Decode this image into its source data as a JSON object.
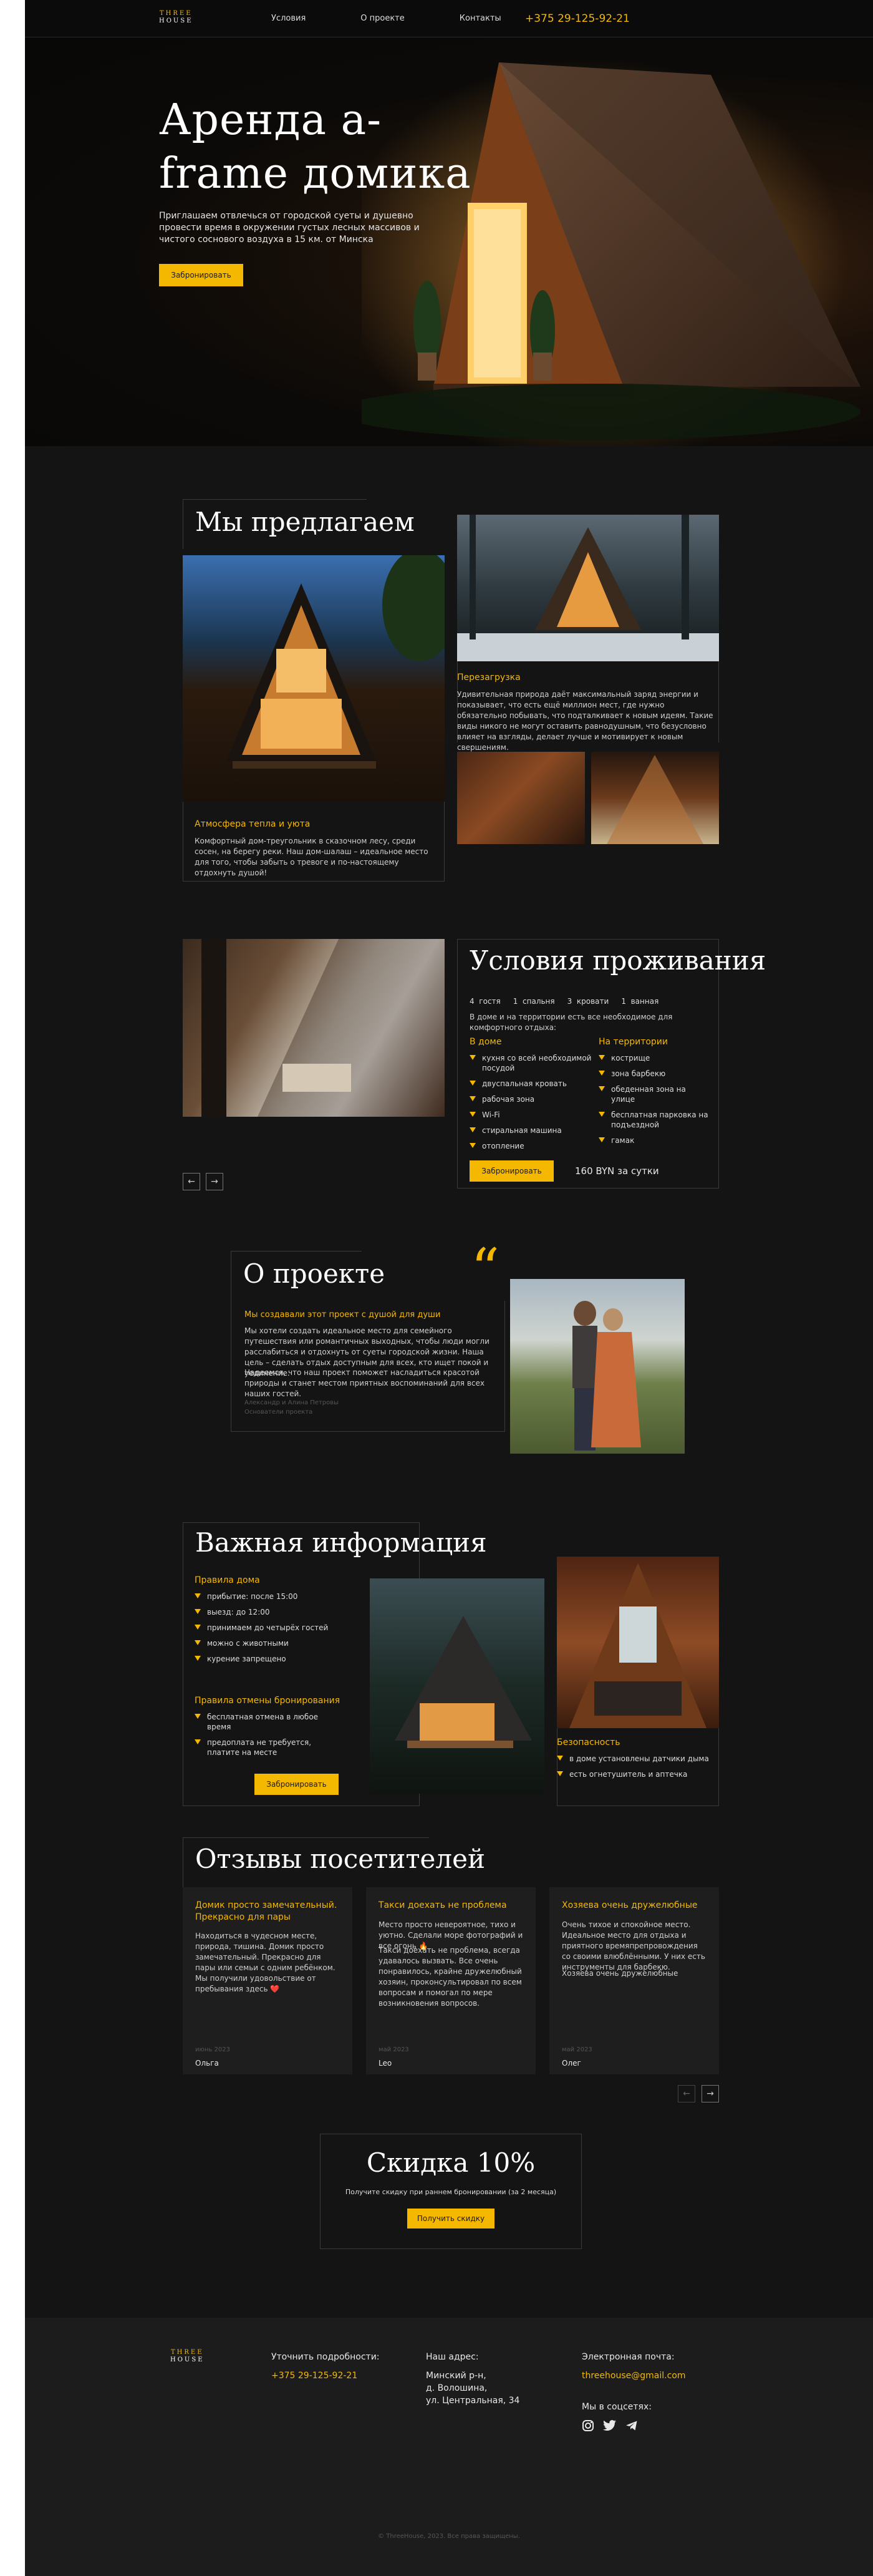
{
  "logo": {
    "top": "THREE",
    "bottom": "HOUSE"
  },
  "nav": {
    "items": [
      "Условия",
      "О проекте",
      "Контакты"
    ],
    "phone": "+375 29-125-92-21"
  },
  "hero": {
    "title": "Аренда a-frame домика",
    "text": "Приглашаем отвлечься от городской суеты и душевно провести время в окружении густых лесных массивов и чистого соснового воздуха в 15 км. от Минска",
    "button": "Забронировать"
  },
  "offer": {
    "title": "Мы предлагаем",
    "card1": {
      "heading": "Атмосфера тепла и уюта",
      "text": "Комфортный дом-треугольник в сказочном лесу, среди сосен, на берегу реки. Наш дом-шалаш – идеальное место для того, чтобы забыть о тревоге и по-настоящему отдохнуть душой!"
    },
    "card2": {
      "heading": "Перезагрузка",
      "text": "Удивительная природа даёт максимальный заряд энергии и показывает, что есть ещё миллион мест, где нужно обязательно побывать, что подталкивает к новым идеям. Такие виды никого не могут оставить равнодушным, что безусловно влияет на взгляды, делает лучше и мотивирует к новым свершениям."
    }
  },
  "conditions": {
    "title": "Условия проживания",
    "stats": [
      {
        "n": "4",
        "l": "гостя"
      },
      {
        "n": "1",
        "l": "спальня"
      },
      {
        "n": "3",
        "l": "кровати"
      },
      {
        "n": "1",
        "l": "ванная"
      }
    ],
    "subtitle": "В доме и на территории есть все необходимое для комфортного отдыха:",
    "house_h": "В доме",
    "house": [
      "кухня со всей необходимой посудой",
      "двуспальная кровать",
      "рабочая зона",
      "Wi-Fi",
      "стиральная машина",
      "отопление"
    ],
    "territory_h": "На территории",
    "territory": [
      "кострище",
      "зона барбекю",
      "обеденная зона на улице",
      "бесплатная парковка на подъездной",
      "гамак"
    ],
    "button": "Забронировать",
    "price": "160 BYN за сутки",
    "prev": "←",
    "next": "→"
  },
  "about": {
    "title": "О проекте",
    "quote": "“",
    "heading": "Мы создавали этот проект с душой для души",
    "p1": "Мы хотели создать идеальное место для семейного путешествия или романтичных выходных, чтобы люди могли расслабиться и отдохнуть от суеты городской жизни. Наша цель – сделать отдых доступным для всех, кто ищет покой и уединение.",
    "p2": "Надеемся, что наш проект поможет насладиться красотой природы и станет местом приятных воспоминаний для всех наших гостей.",
    "sig1": "Александр и Алина Петровы",
    "sig2": "Основатели проекта"
  },
  "info": {
    "title": "Важная информация",
    "rules_h": "Правила дома",
    "rules": [
      "прибытие: после 15:00",
      "выезд: до 12:00",
      "принимаем до четырёх гостей",
      "можно с животными",
      "курение запрещено"
    ],
    "cancel_h": "Правила отмены бронирования",
    "cancel": [
      "бесплатная отмена в любое время",
      "предоплата не требуется, платите на месте"
    ],
    "button": "Забронировать",
    "safety_h": "Безопасность",
    "safety": [
      "в доме установлены датчики дыма",
      "есть огнетушитель и аптечка"
    ]
  },
  "reviews": {
    "title": "Отзывы посетителей",
    "items": [
      {
        "heading": "Домик просто замечательный. Прекрасно для пары",
        "text": "Находиться в чудесном месте, природа, тишина. Домик просто замечательный. Прекрасно для пары или семьи с одним ребёнком. Мы получили удовольствие от пребывания здесь ❤️",
        "text2": "",
        "date": "июнь 2023",
        "name": "Ольга"
      },
      {
        "heading": "Такси доехать не проблема",
        "text": "Место просто невероятное, тихо и уютно. Сделали море фотографий и все огонь 🔥",
        "text2": "Такси доехать не проблема, всегда удавалось вызвать. Все очень понравилось, крайне дружелюбный хозяин, проконсультировал по всем вопросам и помогал по мере возникновения вопросов.",
        "date": "май 2023",
        "name": "Leo"
      },
      {
        "heading": "Хозяева очень дружелюбные",
        "text": "Очень тихое и спокойное место. Идеальное место для отдыха и приятного времяпрепровождения со своими влюблёнными. У них есть инструменты для барбекю.",
        "text2": "Хозяева очень дружелюбные",
        "date": "май 2023",
        "name": "Олег"
      }
    ],
    "prev": "←",
    "next": "→"
  },
  "discount": {
    "title": "Скидка 10%",
    "text": "Получите скидку при раннем бронировании (за 2 месяца)",
    "button": "Получить скидку"
  },
  "footer": {
    "contact_label": "Уточнить подробности:",
    "phone": "+375 29-125-92-21",
    "address_label": "Наш адрес:",
    "address": [
      "Минский р-н,",
      "д. Волошина,",
      "ул. Центральная, 34"
    ],
    "email_label": "Электронная почта:",
    "email": "threehouse@gmail.com",
    "social_label": "Мы в соцсетях:",
    "copyright": "© ThreeHouse, 2023. Все права защищены."
  },
  "colors": {
    "accent": "#f5b800",
    "bg": "#141414",
    "card": "#1e1e1e"
  }
}
